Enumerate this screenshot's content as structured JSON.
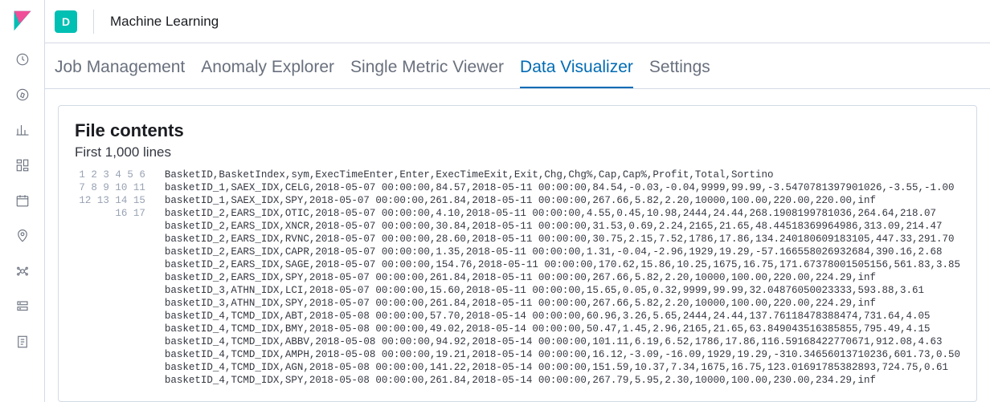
{
  "topbar": {
    "badge_letter": "D",
    "app_title": "Machine Learning"
  },
  "tabs": [
    {
      "label": "Job Management",
      "active": false
    },
    {
      "label": "Anomaly Explorer",
      "active": false
    },
    {
      "label": "Single Metric Viewer",
      "active": false
    },
    {
      "label": "Data Visualizer",
      "active": true
    },
    {
      "label": "Settings",
      "active": false
    }
  ],
  "panel": {
    "title": "File contents",
    "subtitle": "First 1,000 lines"
  },
  "file_lines": [
    "BasketID,BasketIndex,sym,ExecTimeEnter,Enter,ExecTimeExit,Exit,Chg,Chg%,Cap,Cap%,Profit,Total,Sortino",
    "basketID_1,SAEX_IDX,CELG,2018-05-07 00:00:00,84.57,2018-05-11 00:00:00,84.54,-0.03,-0.04,9999,99.99,-3.5470781397901026,-3.55,-1.00",
    "basketID_1,SAEX_IDX,SPY,2018-05-07 00:00:00,261.84,2018-05-11 00:00:00,267.66,5.82,2.20,10000,100.00,220.00,220.00,inf",
    "basketID_2,EARS_IDX,OTIC,2018-05-07 00:00:00,4.10,2018-05-11 00:00:00,4.55,0.45,10.98,2444,24.44,268.1908199781036,264.64,218.07",
    "basketID_2,EARS_IDX,XNCR,2018-05-07 00:00:00,30.84,2018-05-11 00:00:00,31.53,0.69,2.24,2165,21.65,48.44518369964986,313.09,214.47",
    "basketID_2,EARS_IDX,RVNC,2018-05-07 00:00:00,28.60,2018-05-11 00:00:00,30.75,2.15,7.52,1786,17.86,134.2401806091831​05,447.33,291.70",
    "basketID_2,EARS_IDX,CAPR,2018-05-07 00:00:00,1.35,2018-05-11 00:00:00,1.31,-0.04,-2.96,1929,19.29,-57.166558026932684,390.16,2.68",
    "basketID_2,EARS_IDX,SAGE,2018-05-07 00:00:00,154.76,2018-05-11 00:00:00,170.62,15.86,10.25,1675,16.75,171.67378001505156,561.83,3.85",
    "basketID_2,EARS_IDX,SPY,2018-05-07 00:00:00,261.84,2018-05-11 00:00:00,267.66,5.82,2.20,10000,100.00,220.00,224.29,inf",
    "basketID_3,ATHN_IDX,LCI,2018-05-07 00:00:00,15.60,2018-05-11 00:00:00,15.65,0.05,0.32,9999,99.99,32.04876050023333,593.88,3.61",
    "basketID_3,ATHN_IDX,SPY,2018-05-07 00:00:00,261.84,2018-05-11 00:00:00,267.66,5.82,2.20,10000,100.00,220.00,224.29,inf",
    "basketID_4,TCMD_IDX,ABT,2018-05-08 00:00:00,57.70,2018-05-14 00:00:00,60.96,3.26,5.65,2444,24.44,137.76118478388474,731.64,4.05",
    "basketID_4,TCMD_IDX,BMY,2018-05-08 00:00:00,49.02,2018-05-14 00:00:00,50.47,1.45,2.96,2165,21.65,63.849043516385855,795.49,4.15",
    "basketID_4,TCMD_IDX,ABBV,2018-05-08 00:00:00,94.92,2018-05-14 00:00:00,101.11,6.19,6.52,1786,17.86,116.59168422770671,912.08,4.63",
    "basketID_4,TCMD_IDX,AMPH,2018-05-08 00:00:00,19.21,2018-05-14 00:00:00,16.12,-3.09,-16.09,1929,19.29,-310.34656013710236,601.73,0.50",
    "basketID_4,TCMD_IDX,AGN,2018-05-08 00:00:00,141.22,2018-05-14 00:00:00,151.59,10.37,7.34,1675,16.75,123.01691785382893,724.75,0.61",
    "basketID_4,TCMD_IDX,SPY,2018-05-08 00:00:00,261.84,2018-05-14 00:00:00,267.79,5.95,2.30,10000,100.00,230.00,234.29,inf"
  ]
}
